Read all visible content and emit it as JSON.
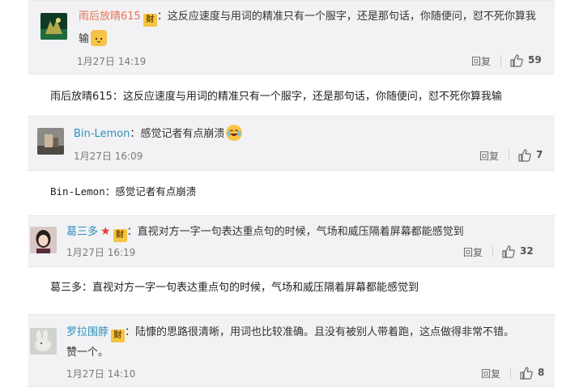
{
  "comments": [
    {
      "user": "雨后放晴615",
      "text_line1": "这反应速度与用词的精准只有一个服字，还是那句话，你随便问，怼不死你算我",
      "text_line2": "输",
      "time": "1月27日 14:19",
      "reply": "回复",
      "likes": "59",
      "quote": "雨后放晴615：这反应速度与用词的精准只有一个服字，还是那句话，你随便问，怼不死你算我输"
    },
    {
      "user": "Bin-Lemon",
      "text_line1": "感觉记者有点崩溃",
      "time": "1月27日 16:09",
      "reply": "回复",
      "likes": "7",
      "quote": "Bin-Lemon：感觉记者有点崩溃"
    },
    {
      "user": "葛三多",
      "text_line1": "直视对方一字一句表达重点句的时候，气场和威压隔着屏幕都能感觉到",
      "time": "1月27日 16:19",
      "reply": "回复",
      "likes": "32",
      "quote": "葛三多：直视对方一字一句表达重点句的时候，气场和威压隔着屏幕都能感觉到"
    },
    {
      "user": "罗拉围脖",
      "text_line1": "陆慷的思路很清晰，用词也比较准确。且没有被别人带着跑，这点做得非常不错。",
      "text_line2": "赞一个。",
      "time": "1月27日 14:10",
      "reply": "回复",
      "likes": "8"
    }
  ],
  "badge_char": "财",
  "colon": "：",
  "icons": {
    "like": "thumbs-up-icon",
    "emoji_1": "cat-face-emoji-icon",
    "emoji_2": "crying-laughing-emoji-icon",
    "vip": "red-star-icon"
  },
  "colors": {
    "card_bg": "#f2f2f5",
    "username_orange": "#eb7350",
    "username_blue": "#2e8fb9",
    "badge": "#f4c543",
    "star": "#e8392b"
  }
}
